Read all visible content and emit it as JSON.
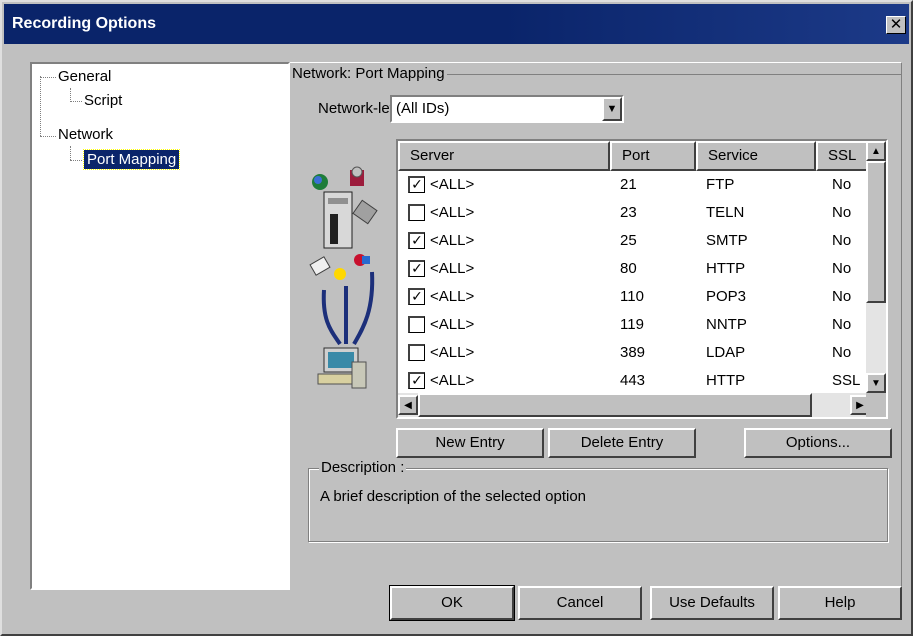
{
  "window": {
    "title": "Recording Options",
    "close_glyph": "✕"
  },
  "tree": {
    "items": [
      {
        "label": "General"
      },
      {
        "label": "Script"
      },
      {
        "label": "Network"
      },
      {
        "label": "Port Mapping"
      }
    ]
  },
  "panel": {
    "group_title": "Network: Port Mapping",
    "mappings_label": "Network-level server address mappings for :",
    "mappings_select": {
      "value": "(All IDs)"
    },
    "columns": [
      "Server",
      "Port",
      "Service",
      "SSL"
    ],
    "rows": [
      {
        "checked": true,
        "server": "<ALL>",
        "port": "21",
        "service": "FTP",
        "ssl": "No"
      },
      {
        "checked": false,
        "server": "<ALL>",
        "port": "23",
        "service": "TELN",
        "ssl": "No"
      },
      {
        "checked": true,
        "server": "<ALL>",
        "port": "25",
        "service": "SMTP",
        "ssl": "No"
      },
      {
        "checked": true,
        "server": "<ALL>",
        "port": "80",
        "service": "HTTP",
        "ssl": "No"
      },
      {
        "checked": true,
        "server": "<ALL>",
        "port": "110",
        "service": "POP3",
        "ssl": "No"
      },
      {
        "checked": false,
        "server": "<ALL>",
        "port": "119",
        "service": "NNTP",
        "ssl": "No"
      },
      {
        "checked": false,
        "server": "<ALL>",
        "port": "389",
        "service": "LDAP",
        "ssl": "No"
      },
      {
        "checked": true,
        "server": "<ALL>",
        "port": "443",
        "service": "HTTP",
        "ssl": "SSL"
      }
    ],
    "buttons": {
      "new_entry": "New Entry",
      "delete_entry": "Delete Entry",
      "options": "Options..."
    },
    "description_title": "Description :",
    "description_text": "A brief description of the selected option"
  },
  "footer": {
    "ok": "OK",
    "cancel": "Cancel",
    "use_defaults": "Use Defaults",
    "help": "Help"
  }
}
